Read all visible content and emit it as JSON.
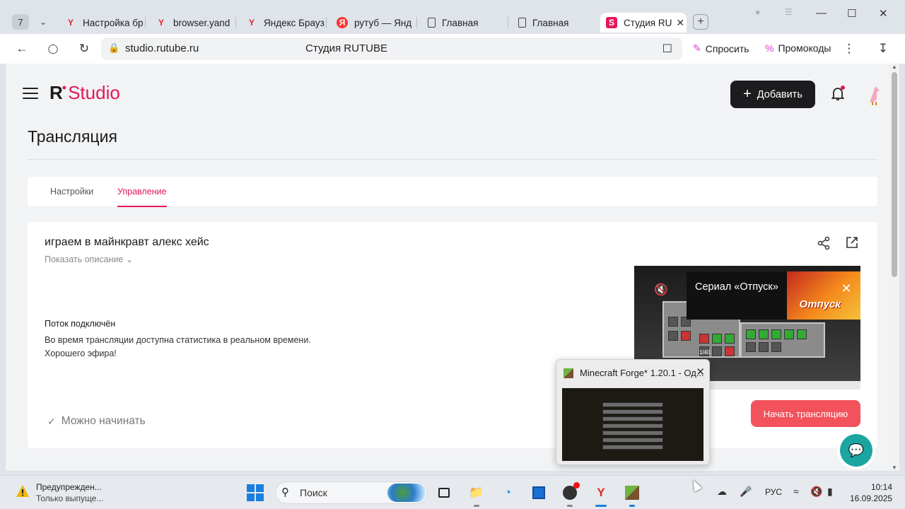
{
  "browser": {
    "tab_count": "7",
    "tabs": [
      {
        "label": "Настройка бр",
        "icon": "yandex-icon"
      },
      {
        "label": "browser.yand",
        "icon": "yandex-icon"
      },
      {
        "label": "Яндекс Брауз",
        "icon": "yandex-icon"
      },
      {
        "label": "рутуб — Янд",
        "icon": "yandex-search-icon"
      },
      {
        "label": "Главная",
        "icon": "document-icon"
      },
      {
        "label": "Главная",
        "icon": "document-icon"
      },
      {
        "label": "Студия RU",
        "icon": "rutube-icon"
      }
    ],
    "url": "studio.rutube.ru",
    "page_title": "Студия RUTUBE",
    "ask_label": "Спросить",
    "promo_label": "Промокоды"
  },
  "app": {
    "logo_r": "R",
    "logo_studio": "Studio",
    "add_label": "Добавить",
    "page_heading": "Трансляция",
    "tabs": [
      {
        "label": "Настройки",
        "active": false
      },
      {
        "label": "Управление",
        "active": true
      }
    ],
    "video_title": "играем в майнкравт алекс хейс",
    "show_description": "Показать описание",
    "stream_status": "Поток подключён",
    "stream_info_1": "Во время трансляции доступна статистика в реальном времени.",
    "stream_info_2": "Хорошего эфира!",
    "ready_label": "Можно начинать",
    "start_label": "Начать трансляцию",
    "ad_title": "Сериал «Отпуск»",
    "ad_logo": "Отпуск",
    "preview_counter": "1/40"
  },
  "popup": {
    "title": "Minecraft Forge* 1.20.1 - Од..."
  },
  "taskbar": {
    "warning_title": "Предупрежден...",
    "warning_subtitle": "Только выпуще...",
    "search_placeholder": "Поиск",
    "language": "РУС",
    "time": "10:14",
    "date": "16.09.2025"
  },
  "colors": {
    "accent": "#e5175c",
    "start_button": "#f2525c",
    "dark_button": "#1c1c1e",
    "chat": "#1aa5a0"
  }
}
